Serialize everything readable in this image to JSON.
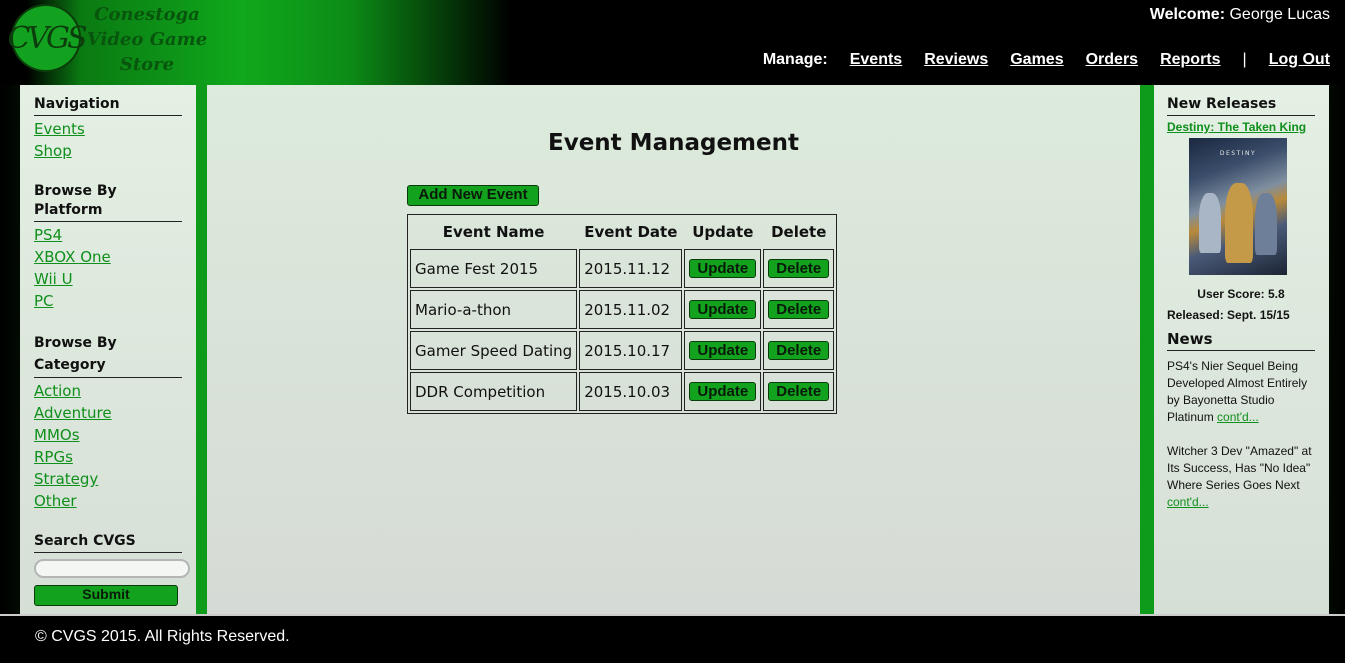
{
  "header": {
    "logo_text": "CVGS",
    "store_name": "Conestoga Video Game Store",
    "welcome_label": "Welcome:",
    "user_name": "George Lucas",
    "manage_label": "Manage:",
    "nav": [
      "Events",
      "Reviews",
      "Games",
      "Orders",
      "Reports"
    ],
    "separator": "|",
    "logout": "Log Out"
  },
  "sidebar": {
    "navigation": {
      "title": "Navigation",
      "items": [
        "Events",
        "Shop"
      ]
    },
    "platform": {
      "title": "Browse By Platform",
      "items": [
        "PS4",
        "XBOX One",
        "Wii U",
        "PC"
      ]
    },
    "category": {
      "title": "Browse By Category",
      "items": [
        "Action",
        "Adventure",
        "MMOs",
        "RPGs",
        "Strategy",
        "Other"
      ]
    },
    "search": {
      "title": "Search CVGS",
      "placeholder": "",
      "submit": "Submit"
    }
  },
  "main": {
    "title": "Event Management",
    "add_button": "Add New Event",
    "columns": [
      "Event Name",
      "Event Date",
      "Update",
      "Delete"
    ],
    "rows": [
      {
        "name": "Game Fest 2015",
        "date": "2015.11.12",
        "update": "Update",
        "delete": "Delete"
      },
      {
        "name": "Mario-a-thon",
        "date": "2015.11.02",
        "update": "Update",
        "delete": "Delete"
      },
      {
        "name": "Gamer Speed Dating",
        "date": "2015.10.17",
        "update": "Update",
        "delete": "Delete"
      },
      {
        "name": "DDR Competition",
        "date": "2015.10.03",
        "update": "Update",
        "delete": "Delete"
      }
    ]
  },
  "right": {
    "new_releases_title": "New Releases",
    "release_title": "Destiny: The Taken King",
    "boxart_text": "DESTINY",
    "user_score": "User Score: 5.8",
    "released": "Released: Sept. 15/15",
    "news_title": "News",
    "news": [
      {
        "text": "PS4's Nier Sequel Being Developed Almost Entirely by Bayonetta Studio Platinum",
        "link": "cont'd..."
      },
      {
        "text": "Witcher 3 Dev \"Amazed\" at Its Success, Has \"No Idea\" Where Series Goes Next",
        "link": "cont'd..."
      }
    ]
  },
  "footer": {
    "text": "© CVGS 2015. All Rights Reserved."
  },
  "colors": {
    "accent": "#12a21d",
    "link": "#0f8f1b",
    "header_bg": "#000000"
  }
}
